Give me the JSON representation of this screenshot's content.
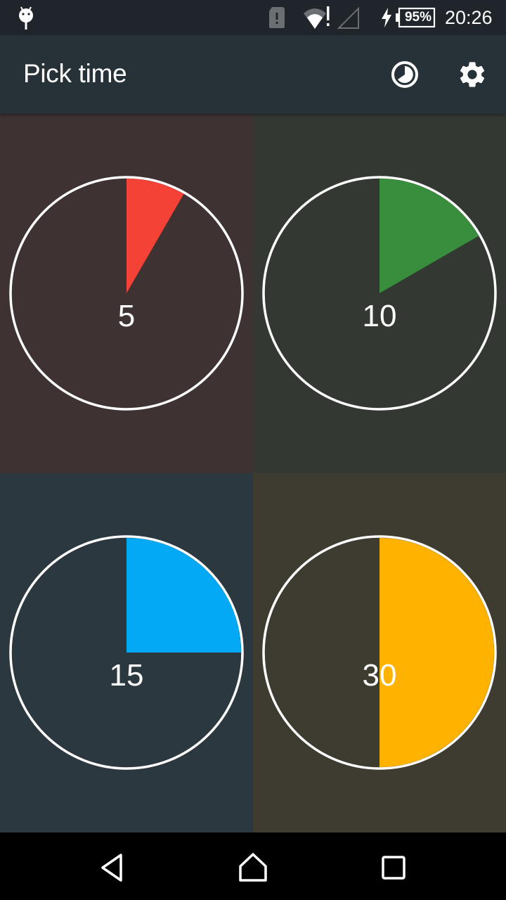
{
  "status_bar": {
    "battery_percent": "95%",
    "time": "20:26",
    "icons": [
      "android-debug-icon",
      "sim-alert-icon",
      "wifi-alert-icon",
      "cell-signal-empty-icon",
      "charging-bolt-icon",
      "battery-icon"
    ]
  },
  "app_bar": {
    "title": "Pick time",
    "actions": [
      {
        "name": "timer-history-icon"
      },
      {
        "name": "settings-gear-icon"
      }
    ]
  },
  "timers": [
    {
      "label": "5",
      "minutes": 5,
      "fraction": 0.0833,
      "color": "#f44336",
      "background": "#3e3233"
    },
    {
      "label": "10",
      "minutes": 10,
      "fraction": 0.1667,
      "color": "#388e3c",
      "background": "#333832"
    },
    {
      "label": "15",
      "minutes": 15,
      "fraction": 0.25,
      "color": "#03a9f4",
      "background": "#2c383f"
    },
    {
      "label": "30",
      "minutes": 30,
      "fraction": 0.5,
      "color": "#ffb300",
      "background": "#3e3c30"
    }
  ],
  "nav_bar": {
    "buttons": [
      "back",
      "home",
      "recents"
    ]
  }
}
